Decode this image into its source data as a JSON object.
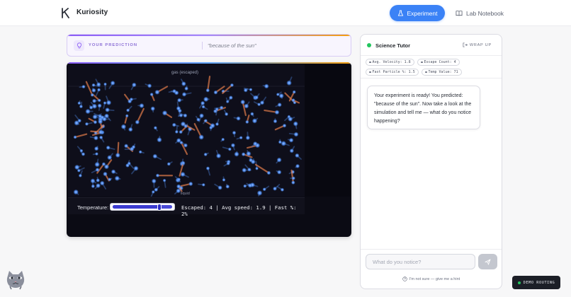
{
  "app": {
    "name": "Kuriosity",
    "nav": {
      "experiment_label": "Experiment",
      "notebook_label": "Lab Notebook"
    }
  },
  "prediction": {
    "label": "YOUR PREDICTION",
    "value": "\"because of the sun\""
  },
  "simulation": {
    "gas_label": "gas (escaped)",
    "liquid_label": "liquid",
    "temperature_label": "Temperature:",
    "temperature_level": 0.78,
    "stats_text": "Escaped: 4 | Avg speed: 1.9 | Fast %: 2%"
  },
  "tutor": {
    "title": "Science Tutor",
    "wrap_up_label": "WRAP UP",
    "chips": [
      "Avg. Velocity: 1.8",
      "Escape Count: 4",
      "Fast Particle %: 1.5",
      "Temp Value: 71"
    ],
    "message": "Your experiment is ready! You predicted: \"because of the sun\". Now take a look at the simulation and tell me — what do you notice happening?",
    "input_placeholder": "What do you notice?",
    "hint_label": "I'm not sure — give me a hint"
  },
  "demo": {
    "label": "DEMO ROUTING"
  },
  "colors": {
    "accent": "#3b82f6",
    "status_green": "#22c55e",
    "prediction_purple": "#8b5cf6"
  },
  "icons": {
    "logo": "k-logo-icon",
    "experiment": "flask-icon",
    "notebook": "book-icon",
    "prediction": "lightbulb-icon",
    "wrap_up": "exit-icon",
    "send": "send-icon",
    "hint": "help-circle-icon",
    "mascot": "cat-mascot-icon"
  }
}
